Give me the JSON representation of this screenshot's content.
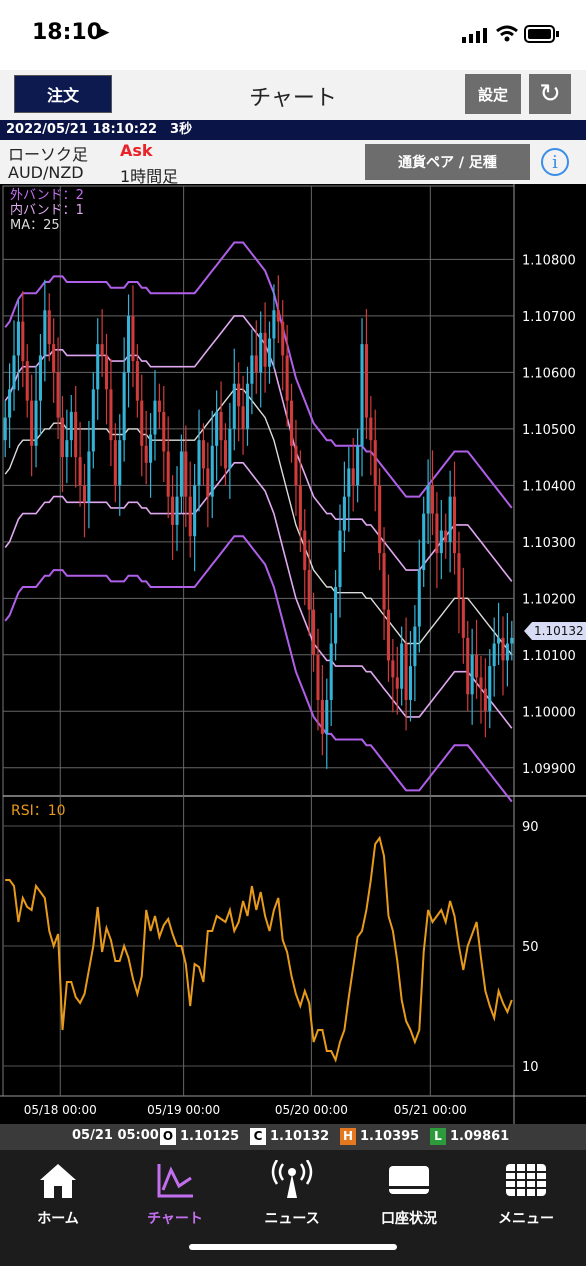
{
  "status_bar": {
    "time": "18:10"
  },
  "header": {
    "order_label": "注文",
    "title": "チャート",
    "settings_label": "設定"
  },
  "datetime_bar": "2022/05/21 18:10:22　3秒",
  "info": {
    "chart_type": "ローソク足",
    "price_side": "Ask",
    "pair": "AUD/NZD",
    "timeframe": "1時間足",
    "pair_button": "通貨ペア / 足種"
  },
  "chart": {
    "legend": [
      "外バンド：2",
      "内バンド：1",
      "MA：25"
    ],
    "price_ticks": [
      "1.10800",
      "1.10700",
      "1.10600",
      "1.10500",
      "1.10400",
      "1.10300",
      "1.10200",
      "1.10100",
      "1.10000",
      "1.09900"
    ],
    "current_price": "1.10132",
    "rsi_label": "RSI：10",
    "rsi_ticks": [
      "90",
      "50",
      "10"
    ],
    "date_ticks": [
      "05/18 00:00",
      "05/19 00:00",
      "05/20 00:00",
      "05/21 00:00"
    ]
  },
  "chart_data": {
    "type": "candlestick",
    "ylim": [
      1.0985,
      1.1093
    ],
    "x_count": 116,
    "close": [
      1.1052,
      1.1057,
      1.1063,
      1.1069,
      1.1062,
      1.1055,
      1.1047,
      1.1055,
      1.1063,
      1.1071,
      1.1065,
      1.106,
      1.1052,
      1.1045,
      1.1048,
      1.1053,
      1.1045,
      1.104,
      1.1037,
      1.1046,
      1.1057,
      1.1065,
      1.1063,
      1.1057,
      1.1048,
      1.104,
      1.1048,
      1.106,
      1.107,
      1.1062,
      1.1055,
      1.1047,
      1.1044,
      1.1049,
      1.1055,
      1.1053,
      1.1046,
      1.1038,
      1.1033,
      1.1038,
      1.1046,
      1.1038,
      1.1031,
      1.104,
      1.1048,
      1.1043,
      1.1038,
      1.1047,
      1.1053,
      1.1048,
      1.1043,
      1.105,
      1.1058,
      1.1054,
      1.105,
      1.1058,
      1.1063,
      1.106,
      1.1067,
      1.1061,
      1.1066,
      1.1071,
      1.1069,
      1.1063,
      1.1055,
      1.1047,
      1.104,
      1.1032,
      1.1025,
      1.1018,
      1.101,
      1.1002,
      1.0996,
      1.1002,
      1.1012,
      1.1022,
      1.1032,
      1.1038,
      1.1043,
      1.104,
      1.1047,
      1.1065,
      1.1052,
      1.1048,
      1.104,
      1.1028,
      1.1018,
      1.1009,
      1.1006,
      1.1004,
      1.1012,
      1.1002,
      1.1008,
      1.1015,
      1.1025,
      1.1035,
      1.104,
      1.1035,
      1.1028,
      1.1032,
      1.103,
      1.1038,
      1.1028,
      1.102,
      1.1013,
      1.1003,
      1.101,
      1.1006,
      1.1004,
      1.1,
      1.1008,
      1.1012,
      1.1013,
      1.1009,
      1.1012,
      1.1013
    ],
    "ma": [
      1.1042,
      1.1043,
      1.1045,
      1.1047,
      1.1048,
      1.1048,
      1.1048,
      1.1048,
      1.1049,
      1.105,
      1.105,
      1.1051,
      1.1051,
      1.1051,
      1.105,
      1.105,
      1.105,
      1.105,
      1.105,
      1.105,
      1.105,
      1.105,
      1.105,
      1.105,
      1.1049,
      1.1049,
      1.1049,
      1.1049,
      1.105,
      1.105,
      1.105,
      1.1049,
      1.1049,
      1.1048,
      1.1048,
      1.1048,
      1.1048,
      1.1048,
      1.1048,
      1.1048,
      1.1048,
      1.1048,
      1.1048,
      1.1048,
      1.1049,
      1.105,
      1.1051,
      1.1052,
      1.1053,
      1.1054,
      1.1055,
      1.1056,
      1.1057,
      1.1057,
      1.1057,
      1.1056,
      1.1055,
      1.1054,
      1.1053,
      1.1052,
      1.105,
      1.1048,
      1.1045,
      1.1042,
      1.1039,
      1.1036,
      1.1033,
      1.1031,
      1.1029,
      1.1027,
      1.1025,
      1.1024,
      1.1023,
      1.1022,
      1.1022,
      1.1021,
      1.1021,
      1.1021,
      1.1021,
      1.1021,
      1.1021,
      1.1021,
      1.102,
      1.102,
      1.1019,
      1.1018,
      1.1017,
      1.1016,
      1.1015,
      1.1014,
      1.1013,
      1.1012,
      1.1012,
      1.1012,
      1.1012,
      1.1013,
      1.1014,
      1.1015,
      1.1016,
      1.1017,
      1.1018,
      1.1019,
      1.102,
      1.102,
      1.102,
      1.102,
      1.1019,
      1.1018,
      1.1017,
      1.1016,
      1.1015,
      1.1014,
      1.1013,
      1.1012,
      1.1011,
      1.101
    ],
    "rsi": [
      72,
      72,
      70,
      58,
      66,
      63,
      62,
      70,
      68,
      66,
      55,
      50,
      54,
      22,
      38,
      38,
      33,
      31,
      34,
      42,
      50,
      63,
      48,
      56,
      52,
      45,
      45,
      50,
      46,
      39,
      34,
      40,
      62,
      55,
      60,
      53,
      57,
      59,
      54,
      50,
      50,
      44,
      30,
      44,
      43,
      38,
      55,
      55,
      60,
      59,
      58,
      62,
      55,
      58,
      65,
      60,
      70,
      62,
      68,
      60,
      55,
      62,
      66,
      52,
      48,
      40,
      34,
      30,
      35,
      31,
      18,
      22,
      22,
      15,
      15,
      12,
      18,
      22,
      33,
      43,
      53,
      55,
      62,
      72,
      84,
      86,
      80,
      60,
      55,
      45,
      32,
      25,
      22,
      18,
      22,
      48,
      62,
      58,
      60,
      62,
      58,
      65,
      60,
      50,
      42,
      50,
      54,
      58,
      46,
      35,
      30,
      26,
      35,
      31,
      28,
      32
    ]
  },
  "ohlc_bar": {
    "time": "05/21 05:00",
    "o": "1.10125",
    "c": "1.10132",
    "h": "1.10395",
    "l": "1.09861",
    "o_tag": "O",
    "c_tag": "C",
    "h_tag": "H",
    "l_tag": "L"
  },
  "tabs": [
    {
      "label": "ホーム"
    },
    {
      "label": "チャート"
    },
    {
      "label": "ニュース"
    },
    {
      "label": "口座状況"
    },
    {
      "label": "メニュー"
    }
  ],
  "colors": {
    "up": "#35b3d6",
    "down": "#d03c3c",
    "outer_band": "#b05fe8",
    "inner_band": "#e0a8f0",
    "ma": "#dcdcdc",
    "rsi": "#e89a1a",
    "active_tab": "#c46ff0"
  }
}
